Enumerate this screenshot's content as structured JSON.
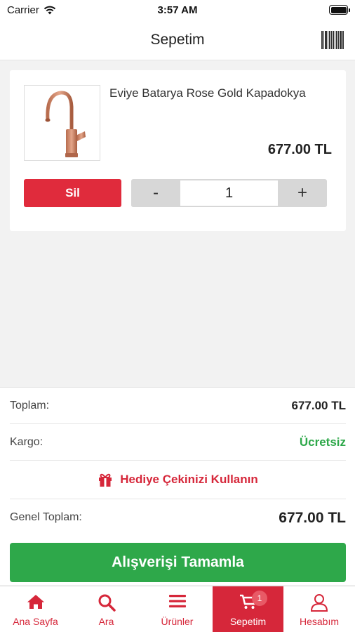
{
  "status_bar": {
    "carrier": "Carrier",
    "time": "3:57 AM"
  },
  "nav": {
    "title": "Sepetim"
  },
  "cart_item": {
    "name": "Eviye Batarya  Rose Gold Kapadokya",
    "price": "677.00 TL",
    "delete_label": "Sil",
    "quantity": "1",
    "minus_label": "-",
    "plus_label": "+"
  },
  "summary": {
    "subtotal_label": "Toplam:",
    "subtotal_value": "677.00 TL",
    "shipping_label": "Kargo:",
    "shipping_value": "Ücretsiz",
    "gift_label": "Hediye Çekinizi Kullanın",
    "grand_total_label": "Genel Toplam:",
    "grand_total_value": "677.00 TL",
    "checkout_label": "Alışverişi Tamamla"
  },
  "tabs": [
    {
      "label": "Ana Sayfa",
      "icon": "home-icon"
    },
    {
      "label": "Ara",
      "icon": "search-icon"
    },
    {
      "label": "Ürünler",
      "icon": "menu-icon"
    },
    {
      "label": "Sepetim",
      "icon": "cart-icon",
      "badge": "1",
      "active": true
    },
    {
      "label": "Hesabım",
      "icon": "user-icon"
    }
  ],
  "colors": {
    "brand_red": "#d6273a",
    "delete_red": "#e02b3c",
    "checkout_green": "#2ea84a",
    "free_shipping_green": "#2ea84a"
  }
}
